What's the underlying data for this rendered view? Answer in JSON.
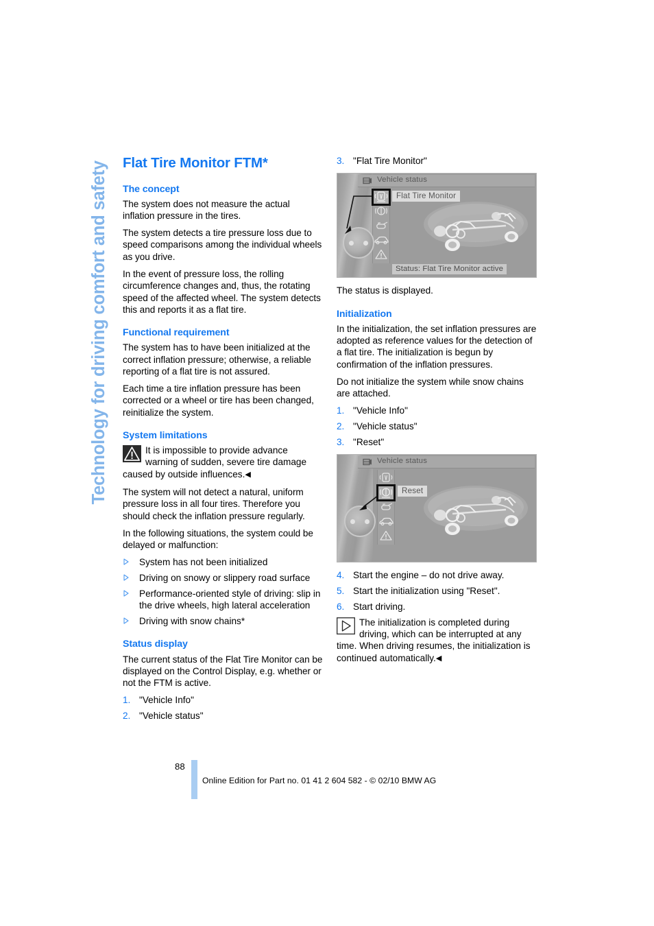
{
  "side_tab": {
    "label": "Technology for driving comfort and safety"
  },
  "title": "Flat Tire Monitor FTM*",
  "left_column": {
    "concept": {
      "heading": "The concept",
      "paragraphs": [
        "The system does not measure the actual inflation pressure in the tires.",
        "The system detects a tire pressure loss due to speed comparisons among the individual wheels as you drive.",
        "In the event of pressure loss, the rolling circumference changes and, thus, the rotating speed of the affected wheel. The system detects this and reports it as a flat tire."
      ]
    },
    "functional_requirement": {
      "heading": "Functional requirement",
      "paragraphs": [
        "The system has to have been initialized at the correct inflation pressure; otherwise, a reliable reporting of a flat tire is not assured.",
        "Each time a tire inflation pressure has been corrected or a wheel or tire has been changed, reinitialize the system."
      ]
    },
    "system_limitations": {
      "heading": "System limitations",
      "warning_icon": "warning-triangle-icon",
      "warning_text": "It is impossible to provide advance warning of sudden, severe tire damage caused by outside influences.",
      "warning_endmark": "◀",
      "paragraphs": [
        "The system will not detect a natural, uniform pressure loss in all four tires. Therefore you should check the inflation pressure regularly.",
        "In the following situations, the system could be delayed or malfunction:"
      ],
      "bullets": [
        "System has not been initialized",
        "Driving on snowy or slippery road surface",
        "Performance-oriented style of driving: slip in the drive wheels, high lateral acceleration",
        "Driving with snow chains*"
      ]
    },
    "status_display": {
      "heading": "Status display",
      "paragraphs": [
        "The current status of the Flat Tire Monitor can be displayed on the Control Display, e.g. whether or not the FTM is active."
      ],
      "steps": [
        {
          "num": "1.",
          "text": "\"Vehicle Info\""
        },
        {
          "num": "2.",
          "text": "\"Vehicle status\""
        }
      ]
    }
  },
  "right_column": {
    "status_steps_continued": [
      {
        "num": "3.",
        "text": "\"Flat Tire Monitor\""
      }
    ],
    "screenshot_status": {
      "header_label": "Vehicle status",
      "header_icon": "vehicle-status-icon",
      "tooltip": "Flat Tire Monitor",
      "status_line": "Status: Flat Tire Monitor active",
      "icons": [
        "flat-tire-monitor-icon",
        "brake-icon",
        "oil-can-icon",
        "vehicle-icon",
        "warning-triangle-icon"
      ],
      "selected_icon_index": 0,
      "controller": "idrive-controller-icon"
    },
    "status_caption": "The status is displayed.",
    "initialization": {
      "heading": "Initialization",
      "paragraphs": [
        "In the initialization, the set inflation pressures are adopted as reference values for the detection of a flat tire. The initialization is begun by confirmation of the inflation pressures.",
        "Do not initialize the system while snow chains are attached."
      ],
      "steps_before": [
        {
          "num": "1.",
          "text": "\"Vehicle Info\""
        },
        {
          "num": "2.",
          "text": "\"Vehicle status\""
        },
        {
          "num": "3.",
          "text": "\"Reset\""
        }
      ],
      "steps_after": [
        {
          "num": "4.",
          "text": "Start the engine – do not drive away."
        },
        {
          "num": "5.",
          "text": "Start the initialization using \"Reset\"."
        },
        {
          "num": "6.",
          "text": "Start driving."
        }
      ],
      "note_icon": "note-triangle-icon",
      "note_text": "The initialization is completed during driving, which can be interrupted at any time. When driving resumes, the initialization is continued automatically.",
      "note_endmark": "◀"
    },
    "screenshot_reset": {
      "header_label": "Vehicle status",
      "header_icon": "vehicle-status-icon",
      "tooltip": "Reset",
      "icons": [
        "flat-tire-monitor-icon",
        "brake-icon",
        "oil-can-icon",
        "vehicle-icon",
        "warning-triangle-icon"
      ],
      "selected_icon_index": 1,
      "controller": "idrive-controller-icon"
    }
  },
  "footer": {
    "page_number": "88",
    "note": "Online Edition for Part no. 01 41 2 604 582 - © 02/10 BMW AG"
  },
  "colors": {
    "heading_blue": "#1478f0",
    "side_tab_blue": "#83b5ea",
    "footer_bar_blue": "#a9cdf2"
  }
}
